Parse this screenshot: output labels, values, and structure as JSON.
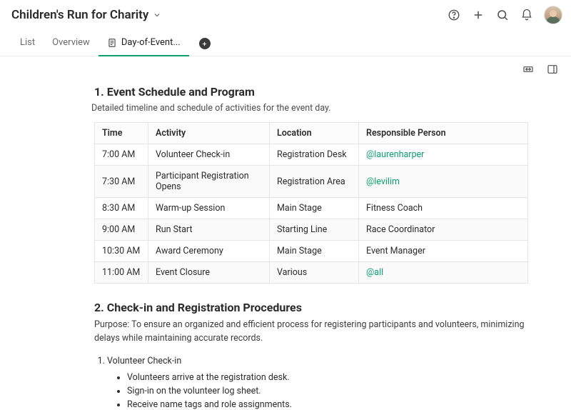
{
  "header": {
    "title": "Children's Run for Charity"
  },
  "tabs": {
    "list": "List",
    "overview": "Overview",
    "active": "Day-of-Event..."
  },
  "section1": {
    "title": "1. Event Schedule and Program",
    "desc": "Detailed timeline and schedule of activities for the event day.",
    "columns": [
      "Time",
      "Activity",
      "Location",
      "Responsible Person"
    ],
    "rows": [
      {
        "time": "7:00 AM",
        "activity": "Volunteer Check-in",
        "location": "Registration Desk",
        "person": "@laurenharper",
        "mention": true
      },
      {
        "time": "7:30 AM",
        "activity": "Participant Registration Opens",
        "location": "Registration Area",
        "person": "@levilim",
        "mention": true
      },
      {
        "time": "8:30 AM",
        "activity": "Warm-up Session",
        "location": "Main Stage",
        "person": "Fitness Coach",
        "mention": false
      },
      {
        "time": "9:00 AM",
        "activity": "Run Start",
        "location": "Starting Line",
        "person": "Race Coordinator",
        "mention": false
      },
      {
        "time": "10:30 AM",
        "activity": "Award Ceremony",
        "location": "Main Stage",
        "person": "Event Manager",
        "mention": false
      },
      {
        "time": "11:00 AM",
        "activity": "Event Closure",
        "location": "Various",
        "person": "@all",
        "mention": true
      }
    ]
  },
  "section2": {
    "title": "2. Check-in and Registration Procedures",
    "desc": "Purpose: To ensure an organized and efficient process for registering participants and volunteers, minimizing delays while maintaining accurate records.",
    "step1_title": "Volunteer Check-in",
    "bullets": [
      "Volunteers arrive at the registration desk.",
      "Sign-in on the volunteer log sheet.",
      "Receive name tags and role assignments."
    ]
  }
}
